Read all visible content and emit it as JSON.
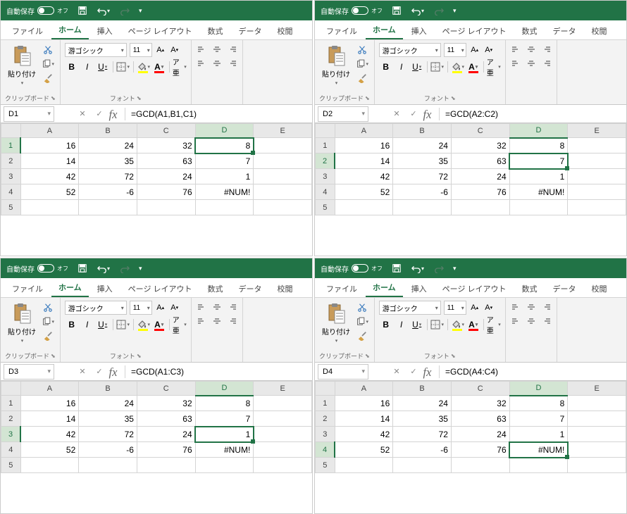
{
  "app": {
    "autosave_label": "自動保存",
    "autosave_state": "オフ"
  },
  "tabs": {
    "file": "ファイル",
    "home": "ホーム",
    "insert": "挿入",
    "pagelayout": "ページ レイアウト",
    "formulas": "数式",
    "data": "データ",
    "review": "校閲"
  },
  "ribbon": {
    "paste_label": "貼り付け",
    "clipboard_group": "クリップボード",
    "font_group": "フォント",
    "font_name": "游ゴシック",
    "font_size": "11",
    "bold": "B",
    "italic": "I",
    "underline": "U",
    "increase_a": "A^",
    "decrease_a": "A˅",
    "ruby": "ア亜"
  },
  "columns": [
    "A",
    "B",
    "C",
    "D",
    "E"
  ],
  "rows": [
    {
      "n": "1",
      "A": "16",
      "B": "24",
      "C": "32",
      "D": "8"
    },
    {
      "n": "2",
      "A": "14",
      "B": "35",
      "C": "63",
      "D": "7"
    },
    {
      "n": "3",
      "A": "42",
      "B": "72",
      "C": "24",
      "D": "1"
    },
    {
      "n": "4",
      "A": "52",
      "B": "-6",
      "C": "76",
      "D": "#NUM!"
    },
    {
      "n": "5",
      "A": "",
      "B": "",
      "C": "",
      "D": ""
    }
  ],
  "panes": [
    {
      "cell_ref": "D1",
      "formula": "=GCD(A1,B1,C1)",
      "sel_row": 0,
      "hl_row": "1"
    },
    {
      "cell_ref": "D2",
      "formula": "=GCD(A2:C2)",
      "sel_row": 1,
      "hl_row": "2"
    },
    {
      "cell_ref": "D3",
      "formula": "=GCD(A1:C3)",
      "sel_row": 2,
      "hl_row": "3"
    },
    {
      "cell_ref": "D4",
      "formula": "=GCD(A4:C4)",
      "sel_row": 3,
      "hl_row": "4"
    }
  ]
}
